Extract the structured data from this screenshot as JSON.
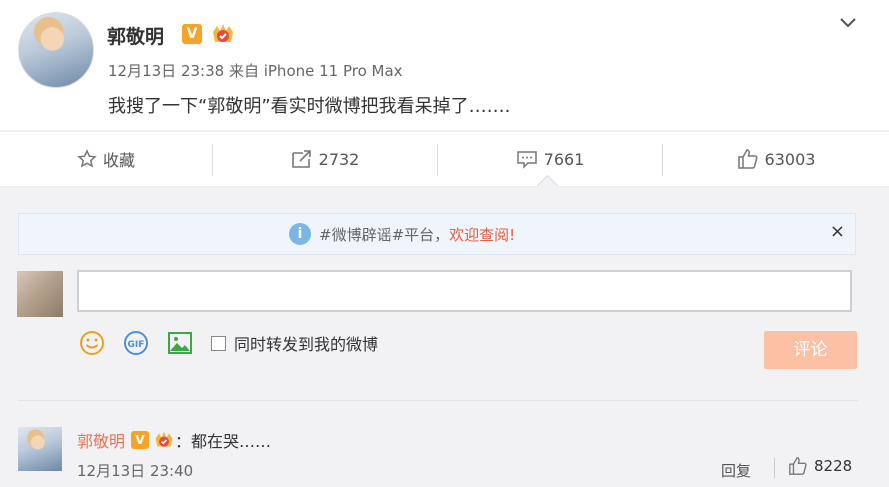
{
  "post": {
    "author": "郭敬明",
    "verified_badge": "V",
    "time": "12月13日 23:38",
    "source": "来自 iPhone 11 Pro Max",
    "text": "我搜了一下“郭敬明”看实时微博把我看呆掉了……."
  },
  "actions": {
    "favorite_label": "收藏",
    "repost_count": "2732",
    "comment_count": "7661",
    "like_count": "63003"
  },
  "notice": {
    "info_glyph": "i",
    "text": "#微博辟谣#平台，",
    "link": "欢迎查阅!",
    "close": "×"
  },
  "composer": {
    "input_value": "",
    "forward_label": "同时转发到我的微博",
    "submit_label": "评论"
  },
  "comment": {
    "author": "郭敬明",
    "verified_badge": "V",
    "text": "：都在哭……",
    "time": "12月13日 23:40",
    "reply_label": "回复",
    "like_count": "8228"
  },
  "colors": {
    "accent": "#eb7350",
    "badge": "#f6a32a",
    "submit_disabled": "#fcc1a4",
    "notice_bg": "#f0f4fb"
  },
  "icons": [
    "chevron-down-icon",
    "star-icon",
    "repost-icon",
    "comment-icon",
    "thumbs-up-icon",
    "info-icon",
    "close-icon",
    "emoji-icon",
    "gif-icon",
    "image-icon",
    "checkbox"
  ]
}
